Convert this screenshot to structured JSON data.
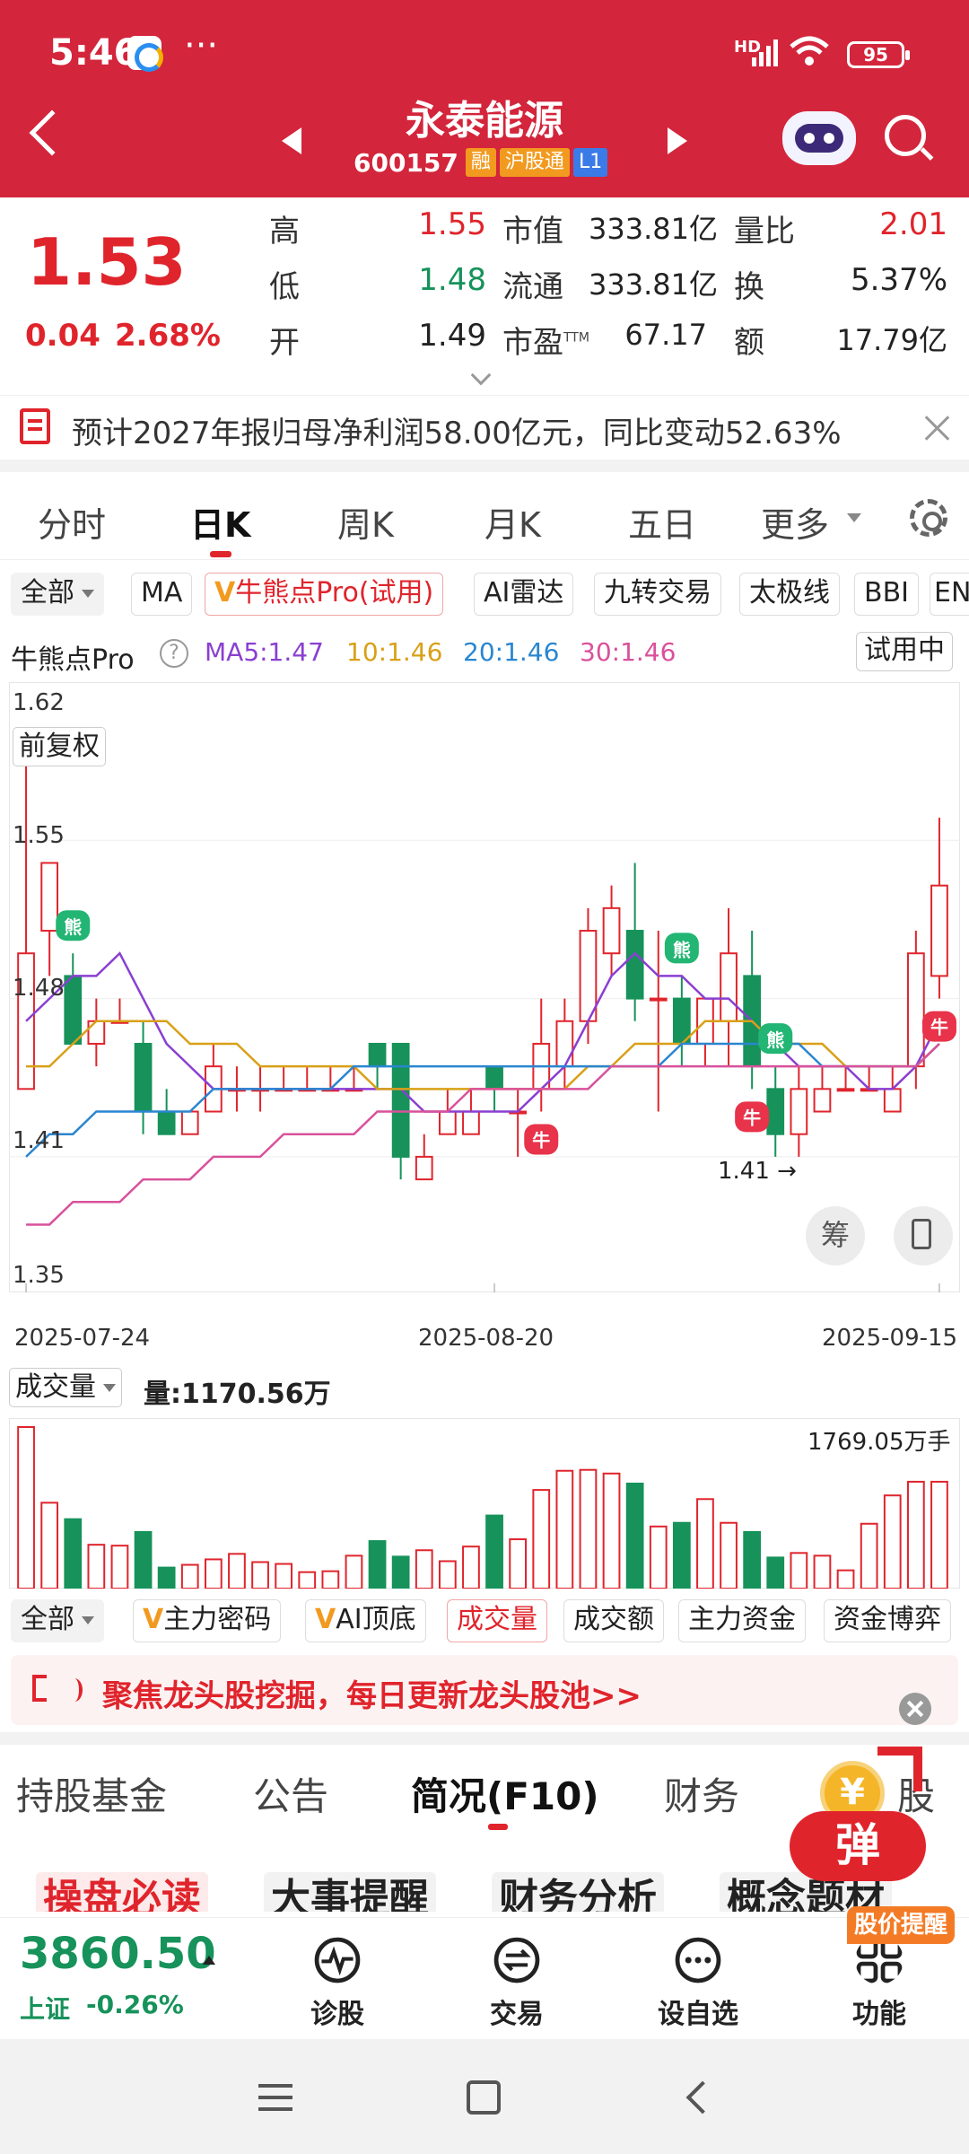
{
  "status_bar": {
    "time": "5:46",
    "more": "···",
    "network": "HD",
    "battery": "95"
  },
  "header": {
    "title": "永泰能源",
    "code": "600157",
    "tags": [
      "融",
      "沪股通",
      "L1"
    ]
  },
  "quote": {
    "price": "1.53",
    "change": "0.04",
    "change_pct": "2.68%",
    "high_label": "高",
    "high": "1.55",
    "low_label": "低",
    "low": "1.48",
    "open_label": "开",
    "open": "1.49",
    "mktcap_label": "市值",
    "mktcap": "333.81亿",
    "float_label": "流通",
    "float": "333.81亿",
    "pe_label": "市盈",
    "pe_sup": "TTM",
    "pe": "67.17",
    "volratio_label": "量比",
    "volratio": "2.01",
    "turnover_label": "换",
    "turnover": "5.37%",
    "amount_label": "额",
    "amount": "17.79亿"
  },
  "notice": {
    "text": "预计2027年报归母净利润58.00亿元，同比变动52.63%"
  },
  "chart_tabs": [
    "分时",
    "日K",
    "周K",
    "月K",
    "五日",
    "更多"
  ],
  "indicator_chips": [
    "全部",
    "MA",
    "牛熊点Pro(试用)",
    "AI雷达",
    "九转交易",
    "太极线",
    "BBI",
    "EN"
  ],
  "legend": {
    "name": "牛熊点Pro",
    "help": "?",
    "ma5": "MA5:1.47",
    "ma10": "10:1.46",
    "ma20": "20:1.46",
    "ma30": "30:1.46",
    "trial": "试用中"
  },
  "colors": {
    "up": "#e0242c",
    "down": "#16925a",
    "ma5": "#8a3fd1",
    "ma10": "#d9a017",
    "ma20": "#2a86d0",
    "ma30": "#d9519b",
    "brand": "#d3253b"
  },
  "chart_data": {
    "type": "candlestick",
    "fuquan": "前复权",
    "y_ticks": [
      "1.62",
      "1.55",
      "1.48",
      "1.41",
      "1.35"
    ],
    "ylim": [
      1.35,
      1.62
    ],
    "x_ticks": [
      "2025-07-24",
      "2025-08-20",
      "2025-09-15"
    ],
    "min_label": "1.41",
    "signal_labels": {
      "bear": "熊",
      "bull": "牛"
    },
    "candles": [
      {
        "o": 1.44,
        "h": 1.6,
        "l": 1.44,
        "c": 1.5
      },
      {
        "o": 1.51,
        "h": 1.53,
        "l": 1.49,
        "c": 1.54
      },
      {
        "o": 1.49,
        "h": 1.5,
        "l": 1.46,
        "c": 1.46
      },
      {
        "o": 1.46,
        "h": 1.48,
        "l": 1.45,
        "c": 1.47
      },
      {
        "o": 1.47,
        "h": 1.48,
        "l": 1.47,
        "c": 1.47
      },
      {
        "o": 1.46,
        "h": 1.47,
        "l": 1.42,
        "c": 1.43
      },
      {
        "o": 1.43,
        "h": 1.44,
        "l": 1.42,
        "c": 1.42
      },
      {
        "o": 1.42,
        "h": 1.43,
        "l": 1.42,
        "c": 1.43
      },
      {
        "o": 1.43,
        "h": 1.46,
        "l": 1.43,
        "c": 1.45
      },
      {
        "o": 1.44,
        "h": 1.45,
        "l": 1.43,
        "c": 1.44
      },
      {
        "o": 1.44,
        "h": 1.45,
        "l": 1.43,
        "c": 1.44
      },
      {
        "o": 1.44,
        "h": 1.45,
        "l": 1.44,
        "c": 1.44
      },
      {
        "o": 1.44,
        "h": 1.45,
        "l": 1.44,
        "c": 1.44
      },
      {
        "o": 1.44,
        "h": 1.45,
        "l": 1.44,
        "c": 1.44
      },
      {
        "o": 1.44,
        "h": 1.45,
        "l": 1.44,
        "c": 1.44
      },
      {
        "o": 1.46,
        "h": 1.46,
        "l": 1.44,
        "c": 1.45
      },
      {
        "o": 1.46,
        "h": 1.46,
        "l": 1.4,
        "c": 1.41
      },
      {
        "o": 1.4,
        "h": 1.42,
        "l": 1.4,
        "c": 1.41
      },
      {
        "o": 1.42,
        "h": 1.44,
        "l": 1.42,
        "c": 1.43
      },
      {
        "o": 1.42,
        "h": 1.44,
        "l": 1.42,
        "c": 1.43
      },
      {
        "o": 1.45,
        "h": 1.45,
        "l": 1.43,
        "c": 1.44
      },
      {
        "o": 1.43,
        "h": 1.44,
        "l": 1.41,
        "c": 1.43
      },
      {
        "o": 1.44,
        "h": 1.48,
        "l": 1.43,
        "c": 1.46
      },
      {
        "o": 1.45,
        "h": 1.48,
        "l": 1.44,
        "c": 1.47
      },
      {
        "o": 1.47,
        "h": 1.52,
        "l": 1.46,
        "c": 1.51
      },
      {
        "o": 1.5,
        "h": 1.53,
        "l": 1.49,
        "c": 1.52
      },
      {
        "o": 1.51,
        "h": 1.54,
        "l": 1.47,
        "c": 1.48
      },
      {
        "o": 1.48,
        "h": 1.51,
        "l": 1.43,
        "c": 1.48
      },
      {
        "o": 1.48,
        "h": 1.49,
        "l": 1.45,
        "c": 1.46
      },
      {
        "o": 1.46,
        "h": 1.48,
        "l": 1.45,
        "c": 1.48
      },
      {
        "o": 1.47,
        "h": 1.52,
        "l": 1.45,
        "c": 1.5
      },
      {
        "o": 1.49,
        "h": 1.51,
        "l": 1.44,
        "c": 1.45
      },
      {
        "o": 1.44,
        "h": 1.45,
        "l": 1.41,
        "c": 1.42
      },
      {
        "o": 1.42,
        "h": 1.45,
        "l": 1.41,
        "c": 1.44
      },
      {
        "o": 1.43,
        "h": 1.45,
        "l": 1.43,
        "c": 1.44
      },
      {
        "o": 1.44,
        "h": 1.45,
        "l": 1.44,
        "c": 1.44
      },
      {
        "o": 1.44,
        "h": 1.45,
        "l": 1.44,
        "c": 1.44
      },
      {
        "o": 1.43,
        "h": 1.45,
        "l": 1.43,
        "c": 1.44
      },
      {
        "o": 1.45,
        "h": 1.51,
        "l": 1.44,
        "c": 1.5
      },
      {
        "o": 1.49,
        "h": 1.56,
        "l": 1.48,
        "c": 1.53
      }
    ],
    "ma5": [
      1.47,
      1.48,
      1.49,
      1.49,
      1.5,
      1.48,
      1.46,
      1.45,
      1.44,
      1.44,
      1.44,
      1.44,
      1.44,
      1.44,
      1.44,
      1.44,
      1.44,
      1.43,
      1.43,
      1.43,
      1.43,
      1.43,
      1.44,
      1.45,
      1.47,
      1.49,
      1.5,
      1.49,
      1.49,
      1.48,
      1.48,
      1.47,
      1.46,
      1.45,
      1.45,
      1.45,
      1.44,
      1.44,
      1.45,
      1.47
    ],
    "ma10": [
      1.45,
      1.45,
      1.46,
      1.47,
      1.47,
      1.47,
      1.47,
      1.46,
      1.46,
      1.46,
      1.45,
      1.45,
      1.45,
      1.45,
      1.45,
      1.44,
      1.44,
      1.44,
      1.44,
      1.44,
      1.44,
      1.44,
      1.44,
      1.44,
      1.45,
      1.45,
      1.46,
      1.46,
      1.46,
      1.47,
      1.47,
      1.47,
      1.46,
      1.46,
      1.46,
      1.45,
      1.45,
      1.45,
      1.45,
      1.46
    ],
    "ma20": [
      1.41,
      1.42,
      1.42,
      1.43,
      1.43,
      1.43,
      1.43,
      1.43,
      1.44,
      1.44,
      1.44,
      1.44,
      1.44,
      1.44,
      1.45,
      1.45,
      1.45,
      1.45,
      1.45,
      1.45,
      1.45,
      1.45,
      1.45,
      1.45,
      1.45,
      1.45,
      1.45,
      1.45,
      1.46,
      1.46,
      1.46,
      1.46,
      1.46,
      1.46,
      1.45,
      1.45,
      1.45,
      1.45,
      1.45,
      1.46
    ],
    "ma30": [
      1.38,
      1.38,
      1.39,
      1.39,
      1.39,
      1.4,
      1.4,
      1.4,
      1.41,
      1.41,
      1.41,
      1.42,
      1.42,
      1.42,
      1.42,
      1.43,
      1.43,
      1.43,
      1.43,
      1.44,
      1.44,
      1.44,
      1.44,
      1.44,
      1.44,
      1.45,
      1.45,
      1.45,
      1.45,
      1.45,
      1.45,
      1.45,
      1.45,
      1.45,
      1.45,
      1.45,
      1.45,
      1.45,
      1.45,
      1.46
    ],
    "bear_signals": [
      2,
      28,
      32
    ],
    "bull_signals": [
      22,
      31,
      39
    ],
    "volume": {
      "label": "量:1170.56万",
      "max_label": "1769.05万手",
      "values": [
        1769,
        940,
        760,
        480,
        470,
        620,
        230,
        260,
        320,
        380,
        290,
        270,
        180,
        190,
        360,
        520,
        350,
        420,
        300,
        460,
        800,
        540,
        1080,
        1290,
        1300,
        1260,
        1150,
        680,
        720,
        980,
        720,
        620,
        340,
        390,
        360,
        200,
        710,
        1020,
        1170,
        1170
      ]
    }
  },
  "volume_select": "成交量",
  "lower_chips": [
    "全部",
    "主力密码",
    "AI顶底",
    "成交量",
    "成交额",
    "主力资金",
    "资金博弈"
  ],
  "banner": {
    "text": "聚焦龙头股挖掘，每日更新龙头股池>>"
  },
  "bottom_tabs": [
    "持股基金",
    "公告",
    "简况(F10)",
    "财务",
    "股"
  ],
  "subtabs": [
    "操盘必读",
    "大事提醒",
    "财务分析",
    "概念题材"
  ],
  "promo": {
    "coin": "¥",
    "label": "弹",
    "alert": "股价提醒"
  },
  "bottom_nav": {
    "index_value": "3860.50",
    "index_name": "上证",
    "index_change": "-0.26%",
    "items": [
      "诊股",
      "交易",
      "设自选",
      "功能"
    ],
    "buttons": {
      "chou": "筹"
    }
  }
}
